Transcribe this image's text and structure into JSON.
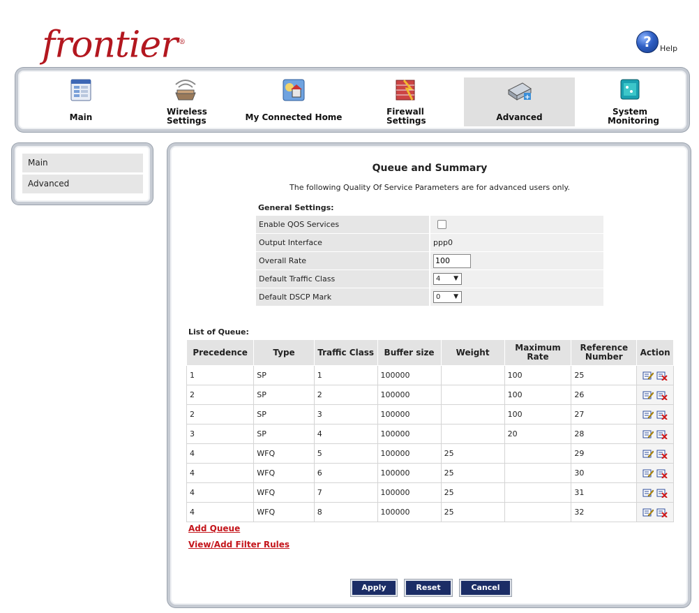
{
  "header": {
    "logo_text": "frontier",
    "help_label": "Help"
  },
  "topnav": [
    {
      "label": "Main",
      "icon": "main-icon"
    },
    {
      "label": "Wireless Settings",
      "icon": "wireless-icon"
    },
    {
      "label": "My Connected Home",
      "icon": "connected-home-icon"
    },
    {
      "label": "Firewall Settings",
      "icon": "firewall-icon"
    },
    {
      "label": "Advanced",
      "icon": "advanced-icon",
      "active": true
    },
    {
      "label": "System Monitoring",
      "icon": "monitor-icon"
    }
  ],
  "sidenav": [
    {
      "label": "Main"
    },
    {
      "label": "Advanced"
    }
  ],
  "page": {
    "title": "Queue and Summary",
    "subtitle": "The following Quality Of Service Parameters are for advanced users only."
  },
  "general": {
    "section_label": "General Settings:",
    "rows": {
      "enable_qos": {
        "label": "Enable QOS Services",
        "checked": false
      },
      "output_interface": {
        "label": "Output Interface",
        "value": "ppp0"
      },
      "overall_rate": {
        "label": "Overall Rate",
        "value": "100"
      },
      "default_traffic_class": {
        "label": "Default Traffic Class",
        "value": "4"
      },
      "default_dscp": {
        "label": "Default DSCP Mark",
        "value": "0"
      }
    }
  },
  "queue": {
    "section_label": "List of Queue:",
    "headers": [
      "Precedence",
      "Type",
      "Traffic Class",
      "Buffer size",
      "Weight",
      "Maximum Rate",
      "Reference Number",
      "Action"
    ],
    "rows": [
      [
        "1",
        "SP",
        "1",
        "100000",
        "",
        "100",
        "25"
      ],
      [
        "2",
        "SP",
        "2",
        "100000",
        "",
        "100",
        "26"
      ],
      [
        "2",
        "SP",
        "3",
        "100000",
        "",
        "100",
        "27"
      ],
      [
        "3",
        "SP",
        "4",
        "100000",
        "",
        "20",
        "28"
      ],
      [
        "4",
        "WFQ",
        "5",
        "100000",
        "25",
        "",
        "29"
      ],
      [
        "4",
        "WFQ",
        "6",
        "100000",
        "25",
        "",
        "30"
      ],
      [
        "4",
        "WFQ",
        "7",
        "100000",
        "25",
        "",
        "31"
      ],
      [
        "4",
        "WFQ",
        "8",
        "100000",
        "25",
        "",
        "32"
      ]
    ]
  },
  "links": {
    "add_queue": "Add Queue",
    "filter_rules": "View/Add Filter Rules"
  },
  "buttons": {
    "apply": "Apply",
    "reset": "Reset",
    "cancel": "Cancel"
  },
  "colors": {
    "brand_red": "#b3171f",
    "button_navy": "#1b2d66"
  }
}
